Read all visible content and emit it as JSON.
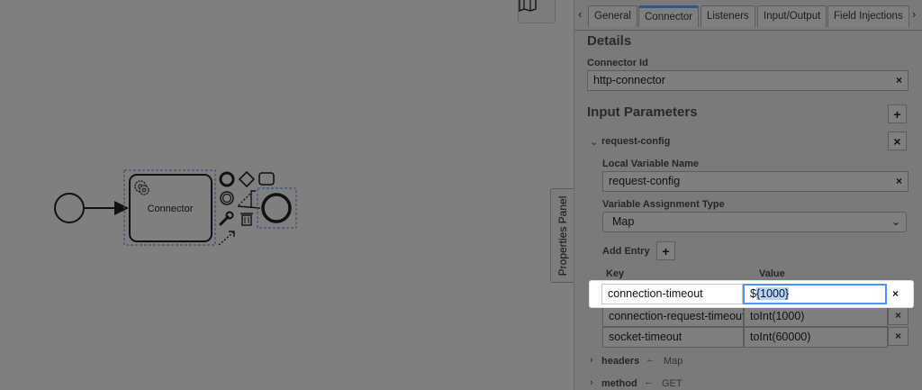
{
  "canvas": {
    "task": {
      "label": "Connector"
    }
  },
  "toggle": {
    "label": "Properties Panel"
  },
  "tabs": {
    "items": [
      {
        "label": "General"
      },
      {
        "label": "Connector"
      },
      {
        "label": "Listeners"
      },
      {
        "label": "Input/Output"
      },
      {
        "label": "Field Injections"
      }
    ],
    "active": "Connector"
  },
  "details": {
    "title": "Details",
    "connector_id_label": "Connector Id",
    "connector_id_value": "http-connector"
  },
  "input_parameters": {
    "title": "Input Parameters",
    "add_symbol": "+",
    "remove_symbol": "×",
    "groups": [
      {
        "name": "request-config",
        "local_variable_name_label": "Local Variable Name",
        "local_variable_name_value": "request-config",
        "assignment_type_label": "Variable Assignment Type",
        "assignment_type_value": "Map",
        "add_entry_label": "Add Entry",
        "key_header": "Key",
        "value_header": "Value",
        "entries": [
          {
            "key": "connection-timeout",
            "value_prefix": "$",
            "value_selected": "{1000}"
          },
          {
            "key": "connection-request-timeout",
            "value": "toInt(1000)"
          },
          {
            "key": "socket-timeout",
            "value": "toInt(60000)"
          }
        ]
      },
      {
        "name": "headers",
        "arrow": "←",
        "type": "Map"
      },
      {
        "name": "method",
        "arrow": "←",
        "type": "GET"
      }
    ]
  },
  "colors": {
    "overlay": "#7f7f7f",
    "focus": "#4d90fe",
    "selection": "#b3d4fc",
    "active_tab": "#2b5a8a"
  }
}
